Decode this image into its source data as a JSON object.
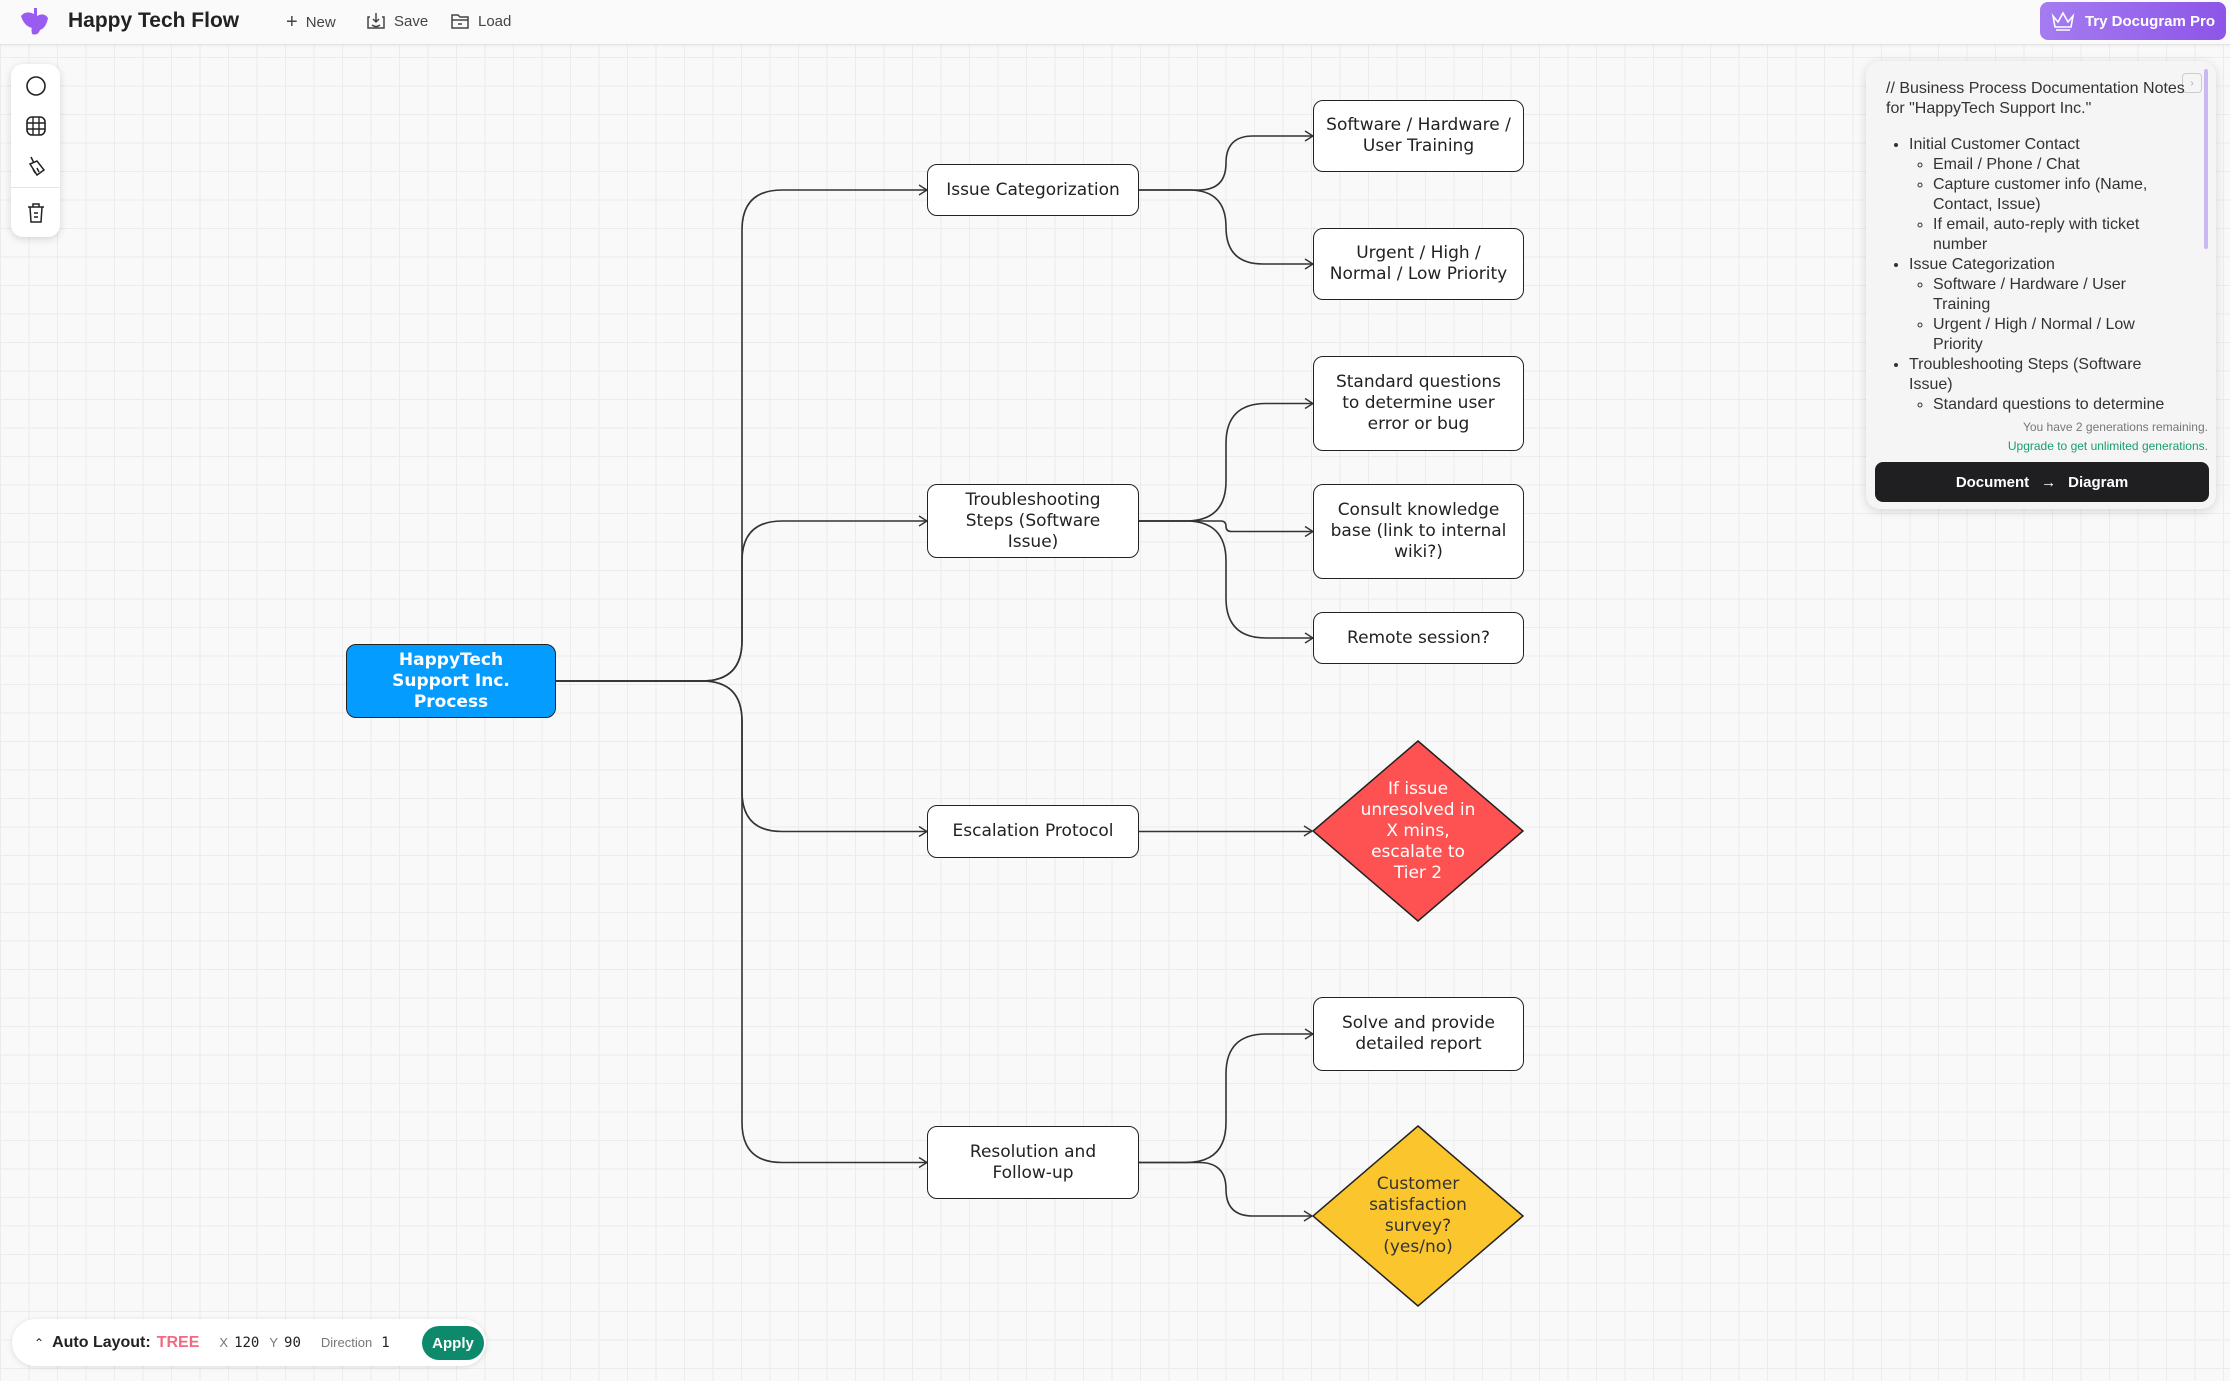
{
  "header": {
    "app_title": "Happy Tech Flow",
    "new_label": "New",
    "save_label": "Save",
    "load_label": "Load",
    "pro_label": "Try Docugram Pro",
    "brand_color": "#9a68ec"
  },
  "toolbar": {
    "icons": [
      "circle-icon",
      "grid-icon",
      "brush-icon",
      "trash-icon"
    ]
  },
  "diagram": {
    "root": "HappyTech Support Inc. Process",
    "categorization": "Issue Categorization",
    "software": "Software / Hardware / User Training",
    "priority": "Urgent / High / Normal / Low Priority",
    "troubleshooting": "Troubleshooting Steps (Software Issue)",
    "standard": "Standard questions to determine user error or bug",
    "consult": "Consult knowledge base (link to internal wiki?)",
    "remote": "Remote session?",
    "escalation": "Escalation Protocol",
    "escalate_decision": "If issue unresolved in X mins, escalate to Tier 2",
    "resolution": "Resolution and Follow-up",
    "solve": "Solve and provide detailed report",
    "survey": "Customer satisfaction survey? (yes/no)",
    "colors": {
      "root": "#049dff",
      "escalate": "#fe5252",
      "survey": "#fbc62d"
    }
  },
  "panel": {
    "header_line": "// Business Process Documentation Notes for \"HappyTech Support Inc.\"",
    "items": [
      {
        "label": "Initial Customer Contact",
        "children": [
          "Email / Phone / Chat",
          "Capture customer info (Name, Contact, Issue)",
          "If email, auto-reply with ticket number"
        ]
      },
      {
        "label": "Issue Categorization",
        "children": [
          "Software / Hardware / User Training",
          "Urgent / High / Normal / Low Priority"
        ]
      },
      {
        "label": "Troubleshooting Steps (Software Issue)",
        "children": [
          "Standard questions to determine"
        ]
      }
    ],
    "generations_note": "You have 2 generations remaining.",
    "upgrade_link": "Upgrade to get unlimited generations.",
    "convert_from": "Document",
    "convert_to": "Diagram"
  },
  "layout_bar": {
    "label": "Auto Layout:",
    "mode": "TREE",
    "x_label": "X",
    "x_value": "120",
    "y_label": "Y",
    "y_value": "90",
    "direction_label": "Direction",
    "direction_value": "1",
    "apply_label": "Apply"
  }
}
